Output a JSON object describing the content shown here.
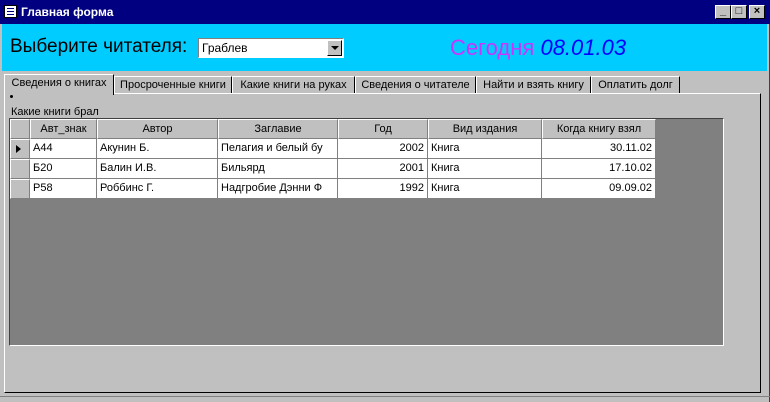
{
  "window": {
    "title": "Главная форма",
    "minimize_label": "_",
    "maximize_label": "□",
    "close_label": "×"
  },
  "header": {
    "choose_reader_label": "Выберите читателя:",
    "reader_selected": "Граблев",
    "today_label": "Сегодня",
    "today_date": "08.01.03",
    "colors": {
      "background": "#00ccff",
      "today_label": "#cc33ff",
      "today_date": "#0000ff"
    }
  },
  "tabs": [
    {
      "label": "Сведения о книгах",
      "active": true
    },
    {
      "label": "Просроченные книги",
      "active": false
    },
    {
      "label": "Какие книги на руках",
      "active": false
    },
    {
      "label": "Сведения о читателе",
      "active": false
    },
    {
      "label": "Найти и взять книгу",
      "active": false
    },
    {
      "label": "Оплатить долг",
      "active": false
    }
  ],
  "books_section": {
    "label": "Какие книги брал",
    "columns": [
      "Авт_знак",
      "Автор",
      "Заглавие",
      "Год",
      "Вид издания",
      "Когда книгу взял"
    ],
    "rows": [
      [
        "А44",
        "Акунин Б.",
        "Пелагия и белый бу",
        "2002",
        "Книга",
        "30.11.02"
      ],
      [
        "Б20",
        "Балин И.В.",
        "Бильярд",
        "2001",
        "Книга",
        "17.10.02"
      ],
      [
        "Р58",
        "Роббинс Г.",
        "Надгробие Дэнни Ф",
        "1992",
        "Книга",
        "09.09.02"
      ]
    ],
    "current_row": 0
  }
}
